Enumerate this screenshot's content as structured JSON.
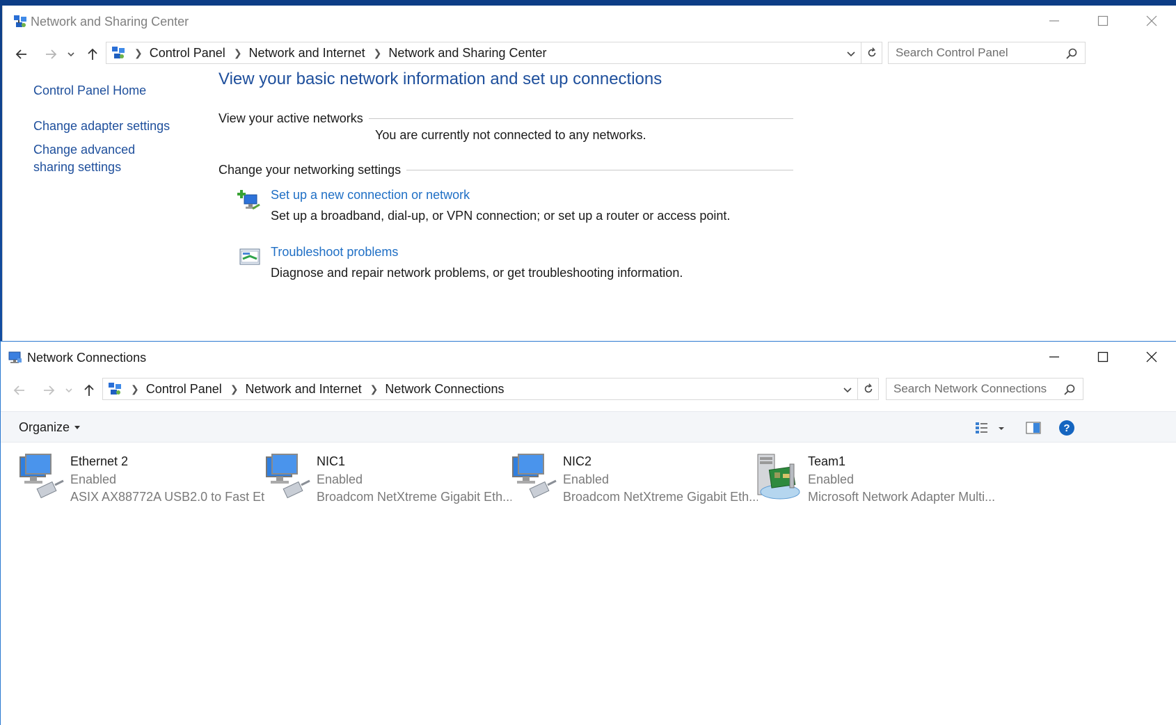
{
  "sharing_center": {
    "title": "Network and Sharing Center",
    "breadcrumbs": [
      "Control Panel",
      "Network and Internet",
      "Network and Sharing Center"
    ],
    "search_placeholder": "Search Control Panel",
    "sidebar": {
      "home": "Control Panel Home",
      "adapter": "Change adapter settings",
      "advanced": "Change advanced sharing settings"
    },
    "heading": "View your basic network information and set up connections",
    "active_networks_label": "View your active networks",
    "not_connected_text": "You are currently not connected to any networks.",
    "networking_settings_label": "Change your networking settings",
    "tasks": [
      {
        "link": "Set up a new connection or network",
        "desc": "Set up a broadband, dial-up, or VPN connection; or set up a router or access point.",
        "icon": "new-connection-icon"
      },
      {
        "link": "Troubleshoot problems",
        "desc": "Diagnose and repair network problems, or get troubleshooting information.",
        "icon": "troubleshoot-icon"
      }
    ]
  },
  "connections": {
    "title": "Network Connections",
    "breadcrumbs": [
      "Control Panel",
      "Network and Internet",
      "Network Connections"
    ],
    "search_placeholder": "Search Network Connections",
    "organize_label": "Organize",
    "items": [
      {
        "name": "Ethernet 2",
        "state": "Enabled",
        "device": "ASIX AX88772A USB2.0 to Fast Et...",
        "icon": "ethernet-adapter-icon"
      },
      {
        "name": "NIC1",
        "state": "Enabled",
        "device": "Broadcom NetXtreme Gigabit Eth...",
        "icon": "ethernet-adapter-icon"
      },
      {
        "name": "NIC2",
        "state": "Enabled",
        "device": "Broadcom NetXtreme Gigabit Eth...",
        "icon": "ethernet-adapter-icon"
      },
      {
        "name": "Team1",
        "state": "Enabled",
        "device": "Microsoft Network Adapter Multi...",
        "icon": "nic-team-icon"
      }
    ]
  },
  "colors": {
    "link_dark": "#1e4f9c",
    "link": "#1f6fc5",
    "help": "#1565c0"
  }
}
